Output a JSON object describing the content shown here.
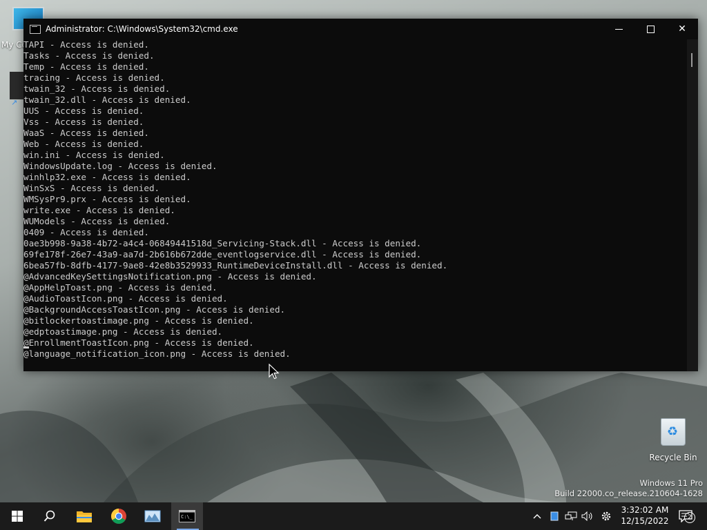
{
  "desktop": {
    "my_computer_label": "My Co",
    "recycle_bin_label": "Recycle Bin",
    "watermark": {
      "line1": "Windows 11 Pro",
      "line2": "Build 22000.co_release.210604-1628"
    }
  },
  "cmd_window": {
    "title": "Administrator:  C:\\Windows\\System32\\cmd.exe",
    "lines": [
      "TAPI - Access is denied.",
      "Tasks - Access is denied.",
      "Temp - Access is denied.",
      "tracing - Access is denied.",
      "twain_32 - Access is denied.",
      "twain_32.dll - Access is denied.",
      "UUS - Access is denied.",
      "Vss - Access is denied.",
      "WaaS - Access is denied.",
      "Web - Access is denied.",
      "win.ini - Access is denied.",
      "WindowsUpdate.log - Access is denied.",
      "winhlp32.exe - Access is denied.",
      "WinSxS - Access is denied.",
      "WMSysPr9.prx - Access is denied.",
      "write.exe - Access is denied.",
      "WUModels - Access is denied.",
      "0409 - Access is denied.",
      "0ae3b998-9a38-4b72-a4c4-06849441518d_Servicing-Stack.dll - Access is denied.",
      "69fe178f-26e7-43a9-aa7d-2b616b672dde_eventlogservice.dll - Access is denied.",
      "6bea57fb-8dfb-4177-9ae8-42e8b3529933_RuntimeDeviceInstall.dll - Access is denied.",
      "@AdvancedKeySettingsNotification.png - Access is denied.",
      "@AppHelpToast.png - Access is denied.",
      "@AudioToastIcon.png - Access is denied.",
      "@BackgroundAccessToastIcon.png - Access is denied.",
      "@bitlockertoastimage.png - Access is denied.",
      "@edptoastimage.png - Access is denied.",
      "@EnrollmentToastIcon.png - Access is denied.",
      "@language_notification_icon.png - Access is denied."
    ]
  },
  "taskbar": {
    "time": "3:32:02 AM",
    "date": "12/15/2022",
    "notification_count": "2",
    "accent": "#7aa7e8"
  }
}
